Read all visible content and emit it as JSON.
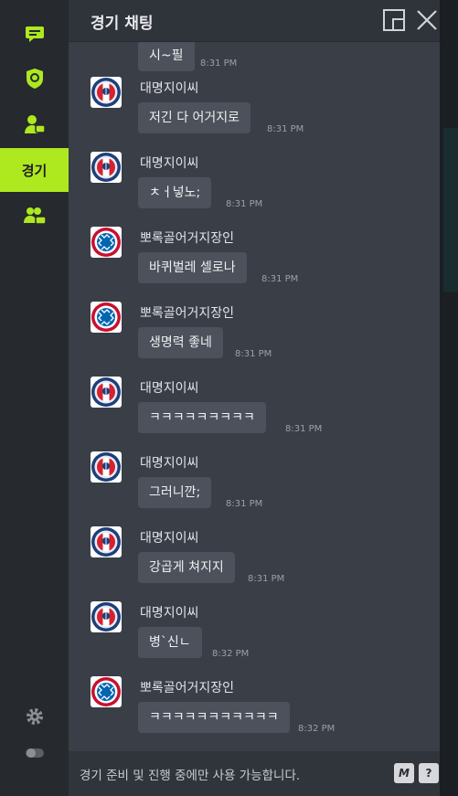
{
  "header": {
    "title": "경기 채팅"
  },
  "sidebar": {
    "items": [
      {
        "name": "chat-icon"
      },
      {
        "name": "shield-icon"
      },
      {
        "name": "user-chat-icon"
      },
      {
        "name": "match-tab",
        "label": "경기"
      },
      {
        "name": "group-chat-icon"
      }
    ]
  },
  "messages": [
    {
      "partial": true,
      "text": "시~필",
      "time": "8:31 PM"
    },
    {
      "user": "대명지이씨",
      "club": "psg",
      "text": "저긴 다 어거지로",
      "time": "8:31 PM"
    },
    {
      "user": "대명지이씨",
      "club": "psg",
      "text": "ㅊㅓ넣노;",
      "time": "8:31 PM"
    },
    {
      "user": "뽀록골어거지장인",
      "club": "bayern",
      "text": "바퀴벌레 셀로나",
      "time": "8:31 PM"
    },
    {
      "user": "뽀록골어거지장인",
      "club": "bayern",
      "text": "생명력 좋네",
      "time": "8:31 PM"
    },
    {
      "user": "대명지이씨",
      "club": "psg",
      "text": "ㅋㅋㅋㅋㅋㅋㅋㅋㅋ",
      "time": "8:31 PM"
    },
    {
      "user": "대명지이씨",
      "club": "psg",
      "text": "그러니깐;",
      "time": "8:31 PM"
    },
    {
      "user": "대명지이씨",
      "club": "psg",
      "text": "강곱게 쳐지지",
      "time": "8:31 PM"
    },
    {
      "user": "대명지이씨",
      "club": "psg",
      "text": "병`신ㄴ",
      "time": "8:32 PM"
    },
    {
      "user": "뽀록골어거지장인",
      "club": "bayern",
      "text": "ㅋㅋㅋㅋㅋㅋㅋㅋㅋㅋㅋ",
      "time": "8:32 PM"
    }
  ],
  "footer": {
    "notice": "경기 준비 및 진행 중에만 사용 가능합니다.",
    "macro_label": "M",
    "help_label": "?"
  },
  "colors": {
    "accent": "#aee81f",
    "panel": "#3a3e47",
    "bubble": "#4c515b"
  }
}
